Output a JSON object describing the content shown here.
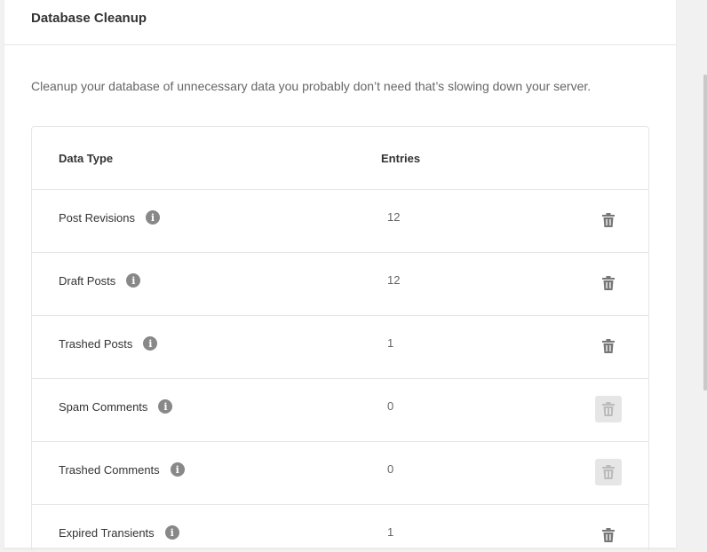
{
  "panel": {
    "title": "Database Cleanup",
    "description": "Cleanup your database of unnecessary data you probably don’t need that’s slowing down your server."
  },
  "table": {
    "headers": {
      "type": "Data Type",
      "entries": "Entries"
    },
    "rows": [
      {
        "label": "Post Revisions",
        "count": "12",
        "delete_enabled": true
      },
      {
        "label": "Draft Posts",
        "count": "12",
        "delete_enabled": true
      },
      {
        "label": "Trashed Posts",
        "count": "1",
        "delete_enabled": true
      },
      {
        "label": "Spam Comments",
        "count": "0",
        "delete_enabled": false
      },
      {
        "label": "Trashed Comments",
        "count": "0",
        "delete_enabled": false
      },
      {
        "label": "Expired Transients",
        "count": "1",
        "delete_enabled": true
      }
    ]
  },
  "icons": {
    "info": "info-icon",
    "delete": "trash-icon"
  },
  "colors": {
    "icon_enabled": "#777777",
    "icon_disabled": "#bbbbbb",
    "disabled_bg": "#e6e6e6"
  }
}
